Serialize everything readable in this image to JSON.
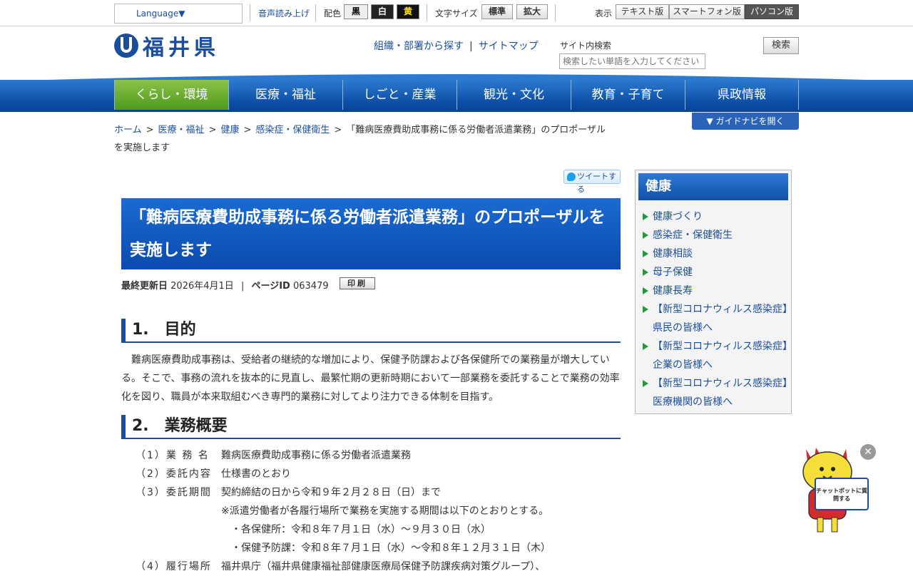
{
  "utility": {
    "language": "Language▼",
    "voice": "音声読み上げ",
    "color_label": "配色",
    "color_options": [
      "黒",
      "白",
      "黄"
    ],
    "size_label": "文字サイズ",
    "size_options": [
      "標準",
      "拡大"
    ],
    "display_label": "表示",
    "display_options": [
      "テキスト版",
      "スマートフォン版",
      "パソコン版"
    ]
  },
  "header": {
    "logo_text": "福井県",
    "links": [
      "組織・部署から探す",
      "サイトマップ"
    ],
    "search_label": "サイト内検索",
    "search_placeholder": "検索したい単語を入力してください",
    "search_button": "検索"
  },
  "gnav": [
    "くらし・環境",
    "医療・福祉",
    "しごと・産業",
    "観光・文化",
    "教育・子育て",
    "県政情報"
  ],
  "breadcrumb": {
    "links": [
      "ホーム",
      "医療・福祉",
      "健康",
      "感染症・保健衛生"
    ],
    "current": "「難病医療費助成事務に係る労働者派遣業務」のプロポーザルを実施します"
  },
  "guide_button": "▼ ガイドナビを開く",
  "tweet": "ツイートする",
  "page": {
    "title": "「難病医療費助成事務に係る労働者派遣業務」のプロポーザルを実施します",
    "updated_label": "最終更新日",
    "updated": "2026年4月1日",
    "page_id_label": "ページID",
    "page_id": "063479",
    "print": "印刷",
    "sections": [
      {
        "heading": "1.　目的",
        "body": "難病医療費助成事務は、受給者の継続的な増加により、保健予防課および各保健所での業務量が増大している。そこで、事務の流れを抜本的に見直し、最繁忙期の更新時期において一部業務を委託することで業務の効率化を図り、職員が本来取組むべき専門的業務に対してより注力できる体制を目指す。"
      },
      {
        "heading": "2.　業務概要"
      }
    ],
    "overview": [
      {
        "k": "（1）業 務 名",
        "v": "難病医療費助成事務に係る労働者派遣業務"
      },
      {
        "k": "（2）委託内容",
        "v": "仕様書のとおり"
      },
      {
        "k": "（3）委託期間",
        "v": "契約締結の日から令和９年２月２８日（日）まで"
      },
      {
        "k": "",
        "v": "※派遣労働者が各履行場所で業務を実施する期間は以下のとおりとする。"
      },
      {
        "k": "",
        "v": "　・各保健所：令和８年７月１日（水）～９月３０日（水）"
      },
      {
        "k": "",
        "v": "　・保健予防課：令和８年７月１日（水）～令和８年１２月３１日（木）"
      },
      {
        "k": "（4）履行場所",
        "v": "福井県庁（福井県健康福祉部健康医療局保健予防課疾病対策グループ）、"
      }
    ]
  },
  "side": {
    "heading": "健康",
    "items": [
      "健康づくり",
      "感染症・保健衛生",
      "健康相談",
      "母子保健",
      "健康長寿",
      "【新型コロナウィルス感染症】県民の皆様へ",
      "【新型コロナウィルス感染症】企業の皆様へ",
      "【新型コロナウィルス感染症】医療機関の皆様へ"
    ]
  },
  "chatbot": {
    "sign": "チャットボットに質問する",
    "close": "✕"
  },
  "colors": {
    "brand": "#1a4e9c",
    "nav": "#0d4fa6",
    "active_nav": "#6aae32",
    "bullet": "#1f9a3c"
  }
}
